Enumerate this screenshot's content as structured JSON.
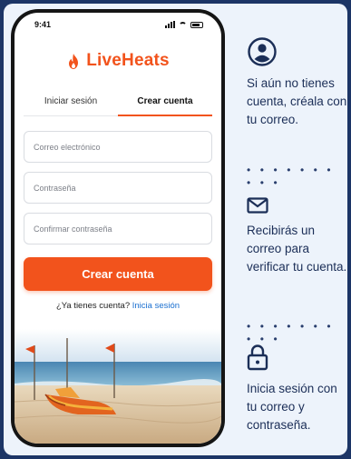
{
  "phone": {
    "status_time": "9:41",
    "app_name": "LiveHeats",
    "tabs": [
      {
        "label": "Iniciar sesión",
        "active": false
      },
      {
        "label": "Crear cuenta",
        "active": true
      }
    ],
    "fields": {
      "email_placeholder": "Correo electrónico",
      "password_placeholder": "Contraseña",
      "confirm_placeholder": "Confirmar contraseña"
    },
    "submit_label": "Crear cuenta",
    "have_account_text": "¿Ya tienes cuenta?",
    "signin_link": "Inicia sesión"
  },
  "steps": [
    {
      "icon": "user-icon",
      "text": "Si aún no tienes cuenta, créala con tu correo."
    },
    {
      "icon": "envelope-icon",
      "text": "Recibirás un correo para verificar tu cuenta."
    },
    {
      "icon": "lock-icon",
      "text": "Inicia sesión con tu correo y contraseña."
    }
  ],
  "colors": {
    "accent": "#f2531c",
    "link": "#1a6fd0",
    "text_dark": "#1b2e57",
    "border": "#1c3566",
    "panel_bg": "#edf3fb"
  }
}
